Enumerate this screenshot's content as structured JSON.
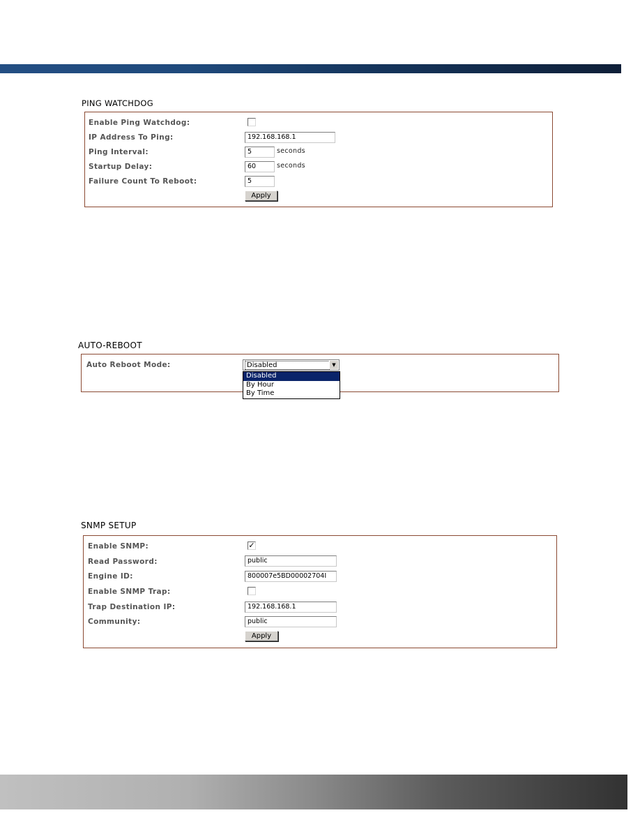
{
  "colors": {
    "header_bar": "#1f4a7c",
    "panel_border": "#8b4a33",
    "dropdown_highlight": "#0a246a"
  },
  "ping_watchdog": {
    "title": "PING WATCHDOG",
    "fields": {
      "enable_label": "Enable Ping Watchdog:",
      "enable_checked": false,
      "ip_label": "IP Address To Ping:",
      "ip_value": "192.168.168.1",
      "interval_label": "Ping Interval:",
      "interval_value": "5",
      "interval_unit": "seconds",
      "startup_label": "Startup Delay:",
      "startup_value": "60",
      "startup_unit": "seconds",
      "failure_label": "Failure Count To Reboot:",
      "failure_value": "5"
    },
    "apply_label": "Apply"
  },
  "auto_reboot": {
    "title": "AUTO-REBOOT",
    "mode_label": "Auto Reboot Mode:",
    "mode_value": "Disabled",
    "options": [
      "Disabled",
      "By Hour",
      "By Time"
    ],
    "highlighted_option": "Disabled"
  },
  "snmp_setup": {
    "title": "SNMP SETUP",
    "fields": {
      "enable_label": "Enable SNMP:",
      "enable_checked": true,
      "read_password_label": "Read Password:",
      "read_password_value": "public",
      "engine_id_label": "Engine ID:",
      "engine_id_value": "800007e5BD00002704I",
      "enable_trap_label": "Enable SNMP Trap:",
      "enable_trap_checked": false,
      "trap_dest_label": "Trap Destination IP:",
      "trap_dest_value": "192.168.168.1",
      "community_label": "Community:",
      "community_value": "public"
    },
    "apply_label": "Apply"
  }
}
